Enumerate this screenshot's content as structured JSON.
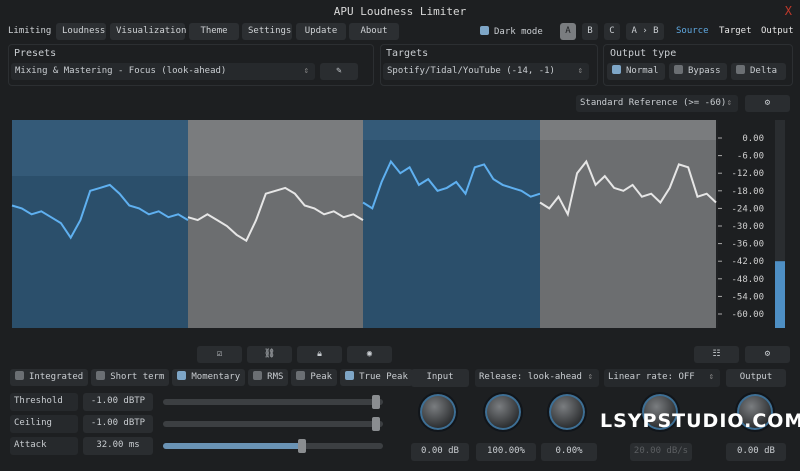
{
  "title": "APU Loudness Limiter",
  "close": "X",
  "tabs": [
    "Limiting",
    "Loudness",
    "Visualization",
    "Theme",
    "Settings",
    "Update",
    "About"
  ],
  "dark_mode": "Dark mode",
  "ab": [
    "A",
    "B",
    "C",
    "A › B"
  ],
  "views": [
    "Source",
    "Target",
    "Output"
  ],
  "presets": {
    "label": "Presets",
    "value": "Mixing & Mastering - Focus (look-ahead)"
  },
  "targets": {
    "label": "Targets",
    "value": "Spotify/Tidal/YouTube (-14, -1)"
  },
  "output_type": {
    "label": "Output type",
    "options": [
      "Normal",
      "Bypass",
      "Delta"
    ]
  },
  "reference": "Standard Reference (>= -60)",
  "scale": [
    "0.00",
    "-6.00",
    "-12.00",
    "-18.00",
    "-24.00",
    "-30.00",
    "-36.00",
    "-42.00",
    "-48.00",
    "-54.00",
    "-60.00"
  ],
  "meter_level_db": -42,
  "loudness_segments": [
    [
      -23,
      -24,
      -26,
      -25,
      -27,
      -29,
      -34,
      -28,
      -18,
      -17,
      -16,
      -19,
      -23,
      -24,
      -26,
      -25,
      -27,
      -26,
      -28
    ],
    [
      -27,
      -28,
      -26,
      -28,
      -30,
      -33,
      -35,
      -28,
      -19,
      -18,
      -17,
      -19,
      -23,
      -24,
      -26,
      -25,
      -27,
      -26,
      -28
    ],
    [
      -22,
      -24,
      -15,
      -8,
      -12,
      -10,
      -16,
      -14,
      -18,
      -17,
      -15,
      -19,
      -10,
      -9,
      -14,
      -16,
      -17,
      -18,
      -20,
      -19
    ],
    [
      -22,
      -24,
      -20,
      -26,
      -12,
      -8,
      -16,
      -13,
      -17,
      -18,
      -16,
      -20,
      -19,
      -22,
      -17,
      -9,
      -10,
      -20,
      -19,
      -22
    ]
  ],
  "modes": [
    "Integrated",
    "Short term",
    "Momentary",
    "RMS",
    "Peak",
    "True Peak"
  ],
  "params": [
    {
      "label": "Threshold",
      "value": "-1.00 dBTP",
      "pct": 97
    },
    {
      "label": "Ceiling",
      "value": "-1.00 dBTP",
      "pct": 97
    },
    {
      "label": "Attack",
      "value": "32.00 ms",
      "pct": 63
    }
  ],
  "knob_headers": {
    "input": "Input",
    "release": "Release: look-ahead",
    "linear": "Linear rate: OFF",
    "output": "Output"
  },
  "knob_values": [
    "0.00 dB",
    "100.00%",
    "0.00%",
    "20.00 dB/s",
    "0.00 dB"
  ],
  "watermark": "LSYPSTUDIO.COM"
}
